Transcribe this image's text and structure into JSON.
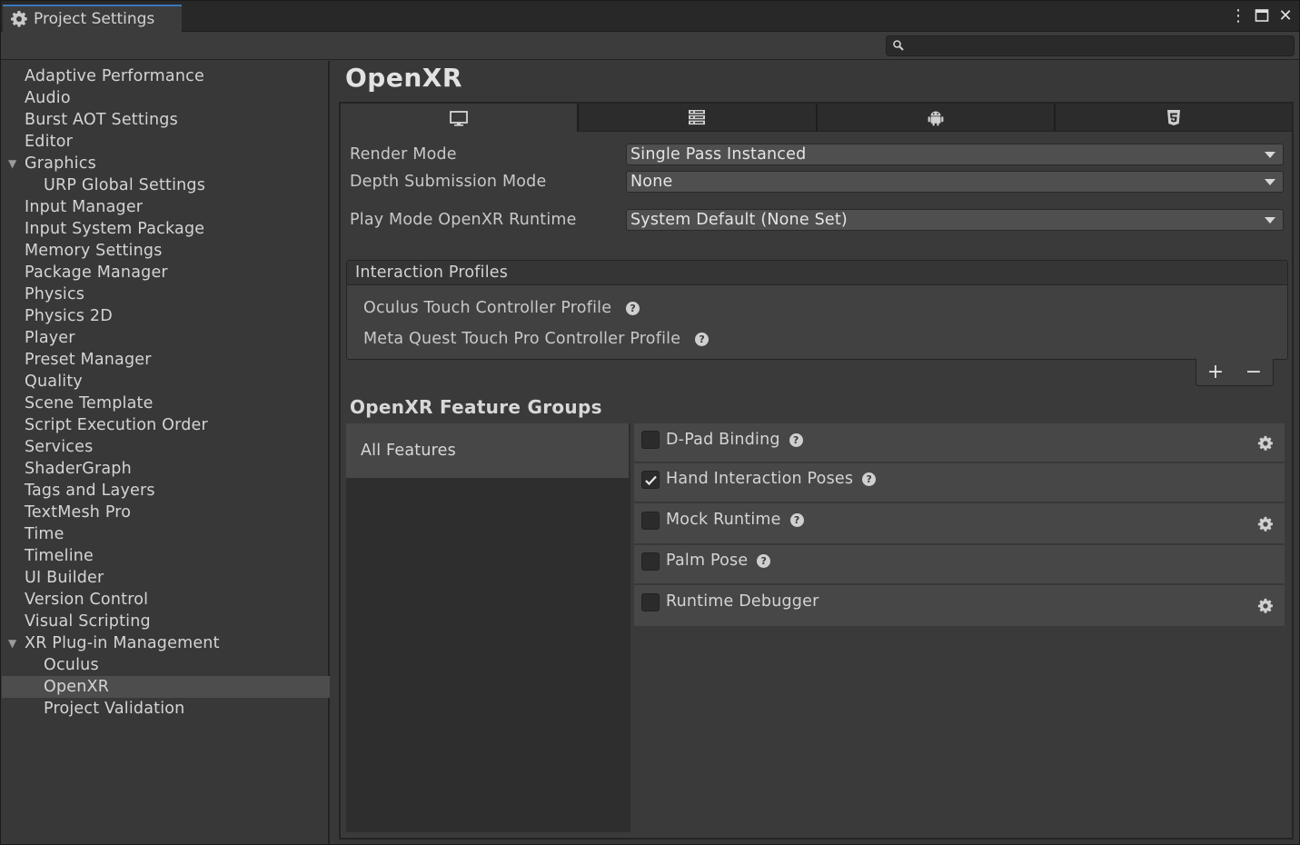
{
  "window": {
    "tab_title": "Project Settings",
    "menu_glyph": "⋮",
    "maximize_glyph": "□",
    "close_glyph": "✕"
  },
  "search": {
    "value": "",
    "placeholder": ""
  },
  "sidebar": {
    "items": [
      {
        "label": "Adaptive Performance"
      },
      {
        "label": "Audio"
      },
      {
        "label": "Burst AOT Settings"
      },
      {
        "label": "Editor"
      },
      {
        "label": "Graphics"
      },
      {
        "label": "URP Global Settings"
      },
      {
        "label": "Input Manager"
      },
      {
        "label": "Input System Package"
      },
      {
        "label": "Memory Settings"
      },
      {
        "label": "Package Manager"
      },
      {
        "label": "Physics"
      },
      {
        "label": "Physics 2D"
      },
      {
        "label": "Player"
      },
      {
        "label": "Preset Manager"
      },
      {
        "label": "Quality"
      },
      {
        "label": "Scene Template"
      },
      {
        "label": "Script Execution Order"
      },
      {
        "label": "Services"
      },
      {
        "label": "ShaderGraph"
      },
      {
        "label": "Tags and Layers"
      },
      {
        "label": "TextMesh Pro"
      },
      {
        "label": "Time"
      },
      {
        "label": "Timeline"
      },
      {
        "label": "UI Builder"
      },
      {
        "label": "Version Control"
      },
      {
        "label": "Visual Scripting"
      },
      {
        "label": "XR Plug-in Management"
      },
      {
        "label": "Oculus"
      },
      {
        "label": "OpenXR"
      },
      {
        "label": "Project Validation"
      }
    ],
    "expand_arrow": "▼"
  },
  "main": {
    "title": "OpenXR",
    "platform_tabs": [
      {
        "icon": "desktop-icon"
      },
      {
        "icon": "server-icon"
      },
      {
        "icon": "android-icon"
      },
      {
        "icon": "webgl-icon"
      }
    ],
    "fields": {
      "render_mode": {
        "label": "Render Mode",
        "value": "Single Pass Instanced"
      },
      "depth_submission": {
        "label": "Depth Submission Mode",
        "value": "None"
      },
      "play_mode_runtime": {
        "label": "Play Mode OpenXR Runtime",
        "value": "System Default (None Set)"
      }
    },
    "interaction_profiles": {
      "header": "Interaction Profiles",
      "items": [
        {
          "label": "Oculus Touch Controller Profile"
        },
        {
          "label": "Meta Quest Touch Pro Controller Profile"
        }
      ],
      "add": "+",
      "remove": "−"
    },
    "feature_groups": {
      "title": "OpenXR Feature Groups",
      "groups": [
        {
          "label": "All Features"
        }
      ],
      "features": [
        {
          "label": "D-Pad Binding",
          "checked": false,
          "settings": true
        },
        {
          "label": "Hand Interaction Poses",
          "checked": true,
          "settings": false
        },
        {
          "label": "Mock Runtime",
          "checked": false,
          "settings": true
        },
        {
          "label": "Palm Pose",
          "checked": false,
          "settings": false
        },
        {
          "label": "Runtime Debugger",
          "checked": false,
          "settings": true
        }
      ]
    },
    "help_glyph": "?"
  }
}
